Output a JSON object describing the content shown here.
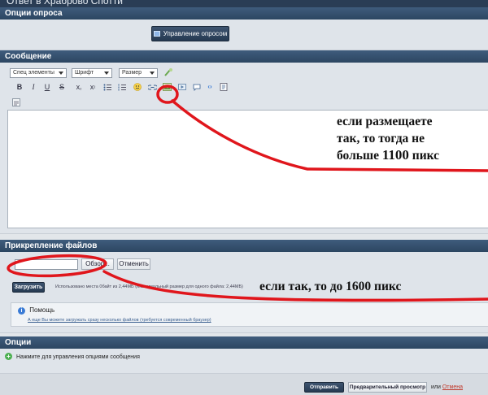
{
  "window": {
    "title": "Ответ в Храброво Спотти"
  },
  "poll": {
    "header": "Опции опроса",
    "manage_button": "Управление опросом"
  },
  "message": {
    "header": "Сообщение",
    "selects": [
      {
        "label": "Спец элементы"
      },
      {
        "label": "Шрифт"
      },
      {
        "label": "Размер"
      }
    ],
    "toolbar": {
      "bold": "B",
      "italic": "I",
      "underline": "U",
      "strike": "S",
      "subscript": "x",
      "sub_mark": "₂",
      "superscript": "x",
      "sup_mark": "²"
    }
  },
  "annotations": {
    "editor_note_lines": [
      "если размещаете",
      "так, то тогда не",
      "больше"
    ],
    "editor_note_number": "1100",
    "editor_note_unit": "пикс",
    "upload_note": "если так, то до 1600 пикс"
  },
  "attachments": {
    "header": "Прикрепление файлов",
    "file_value": "",
    "browse_button": "Обзор...",
    "cancel_button": "Отменить",
    "upload_button": "Загрузить",
    "usage_text": "Использовано места 0байт из 2,44МБ (Максимальный размер для одного файла: 2,44МБ)",
    "help_title": "Помощь",
    "help_link": "А еще Вы можете загружать сразу несколько файлов (требуется современный браузер)"
  },
  "options": {
    "header": "Опции",
    "item": "Нажмите для управления опциями сообщения"
  },
  "footer": {
    "submit_button": "Отправить",
    "preview_button": "Предварительный просмотр",
    "or_text": "или",
    "cancel_link": "Отмена"
  },
  "colors": {
    "header_bg": "#2c4661",
    "accent_red": "#e0161c",
    "link_red": "#c0392b"
  }
}
